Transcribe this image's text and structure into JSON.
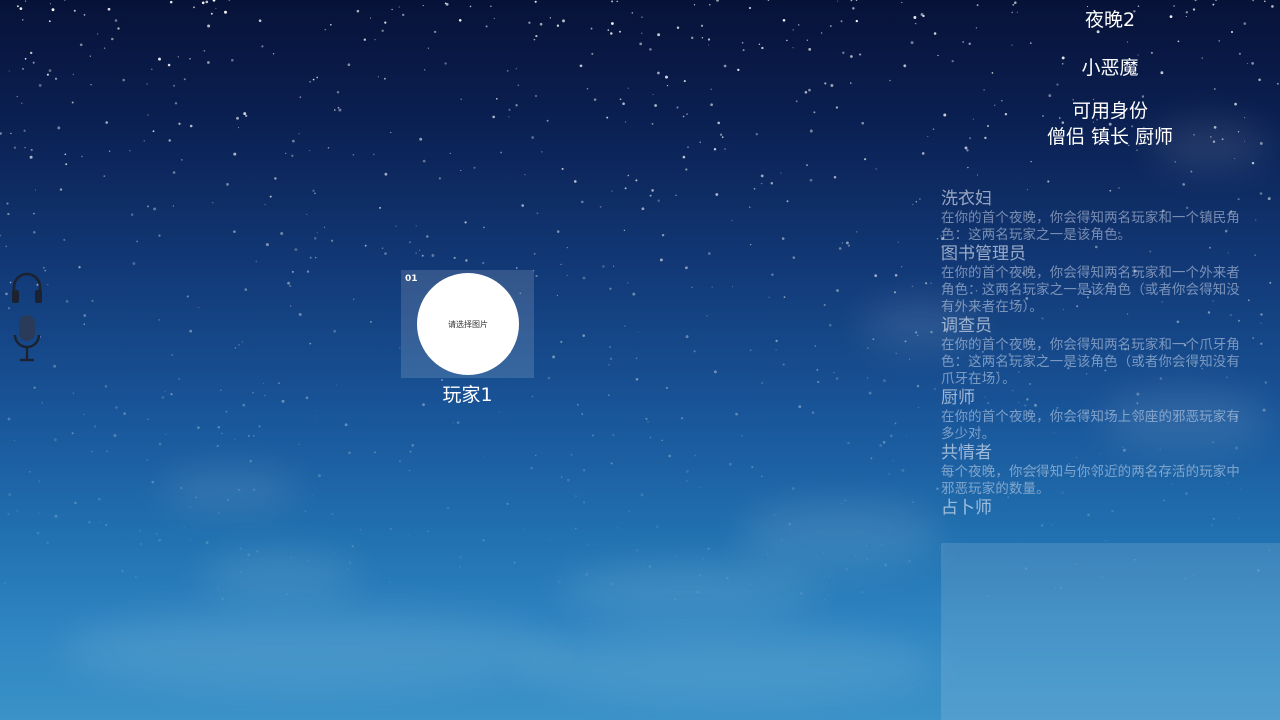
{
  "colors": {
    "sky_top": "#071238",
    "sky_bottom": "#3a92c8",
    "text": "#ffffff",
    "avatar_bg": "#ffffff"
  },
  "icons": {
    "headphone": "headphone-icon",
    "microphone": "microphone-icon"
  },
  "header": {
    "night": "夜晚2",
    "role": "小恶魔",
    "available_label": "可用身份",
    "available_roles": "僧侣 镇长 厨师"
  },
  "seat": {
    "number": "01",
    "avatar_placeholder": "请选择图片",
    "player_name": "玩家1"
  },
  "roles": [
    {
      "title": "洗衣妇",
      "desc": "在你的首个夜晚，你会得知两名玩家和一个镇民角色：这两名玩家之一是该角色。"
    },
    {
      "title": "图书管理员",
      "desc": "在你的首个夜晚，你会得知两名玩家和一个外来者角色：这两名玩家之一是该角色（或者你会得知没有外来者在场）。"
    },
    {
      "title": "调查员",
      "desc": "在你的首个夜晚，你会得知两名玩家和一个爪牙角色：这两名玩家之一是该角色（或者你会得知没有爪牙在场）。"
    },
    {
      "title": "厨师",
      "desc": "在你的首个夜晚，你会得知场上邻座的邪恶玩家有多少对。"
    },
    {
      "title": "共情者",
      "desc": "每个夜晚，你会得知与你邻近的两名存活的玩家中邪恶玩家的数量。"
    },
    {
      "title": "占卜师",
      "desc": ""
    }
  ]
}
